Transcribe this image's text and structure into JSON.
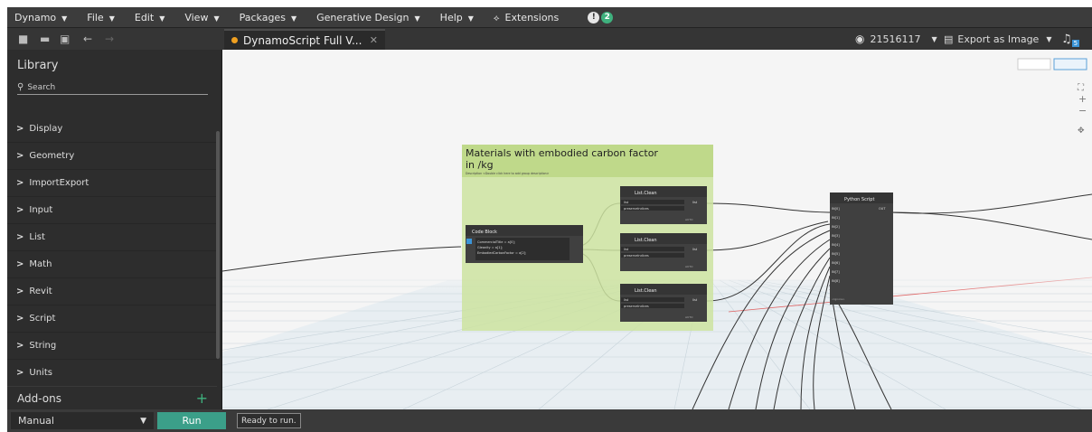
{
  "menu": {
    "items": [
      "Dynamo",
      "File",
      "Edit",
      "View",
      "Packages",
      "Generative Design",
      "Help"
    ],
    "extensions": "Extensions",
    "notifications": {
      "info": "!",
      "count": "2"
    }
  },
  "toolbar": {
    "tab_title": "DynamoScript Full V...",
    "user_id": "21516117",
    "export_label": "Export as Image",
    "bell_badge": "5"
  },
  "library": {
    "title": "Library",
    "search_placeholder": "Search",
    "categories": [
      "Display",
      "Geometry",
      "ImportExport",
      "Input",
      "List",
      "Math",
      "Revit",
      "Script",
      "String",
      "Units"
    ],
    "addons": "Add-ons"
  },
  "graph": {
    "group_title": "Materials with embodied carbon factor in /kg",
    "group_desc": "Description <Double click here to add group description>",
    "code_block": {
      "title": "Code Block",
      "lines": [
        "CommercialTitle = a[0];",
        "Gleanity = a[1];",
        "EmbodiedCarbonFactor = a[2];"
      ]
    },
    "list_clean_title": "List.Clean",
    "list_port": "list",
    "preserve_port": "preserveIndices",
    "list_out": "list",
    "auto": "AUTO",
    "python": {
      "title": "Python Script",
      "inputs": [
        "IN[0]",
        "IN[1]",
        "IN[2]",
        "IN[3]",
        "IN[4]",
        "IN[5]",
        "IN[6]",
        "IN[7]",
        "IN[8]"
      ],
      "output": "OUT",
      "footer": "<Ignore>"
    }
  },
  "status": {
    "mode": "Manual",
    "run_label": "Run",
    "message": "Ready to run."
  },
  "colors": {
    "accent": "#3fb17e",
    "run": "#3b9f89",
    "group": "#cde3a0",
    "node_header": "#3c3c3c",
    "port": "#3b95d8"
  }
}
